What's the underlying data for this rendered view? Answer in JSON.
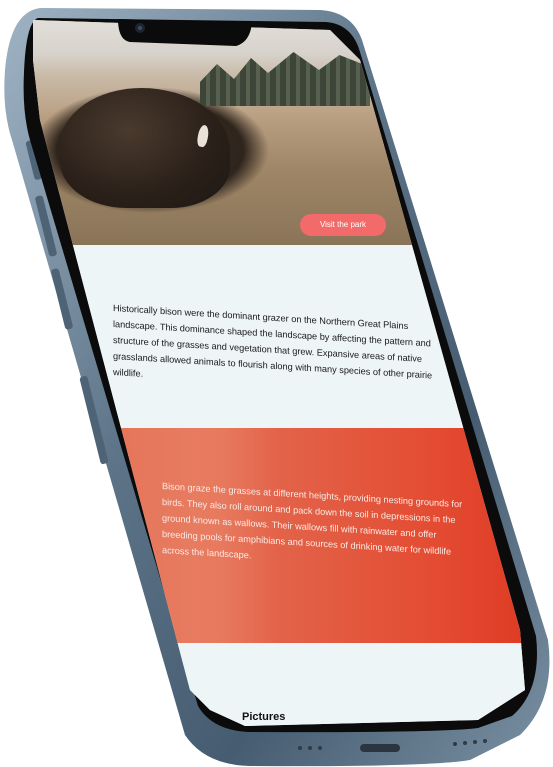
{
  "hero": {
    "visit_label": "Visit the park"
  },
  "section1": {
    "text": "Historically bison were the dominant grazer on the Northern Great Plains landscape. This dominance shaped the landscape by affecting the pattern and structure of the grasses and vegetation that grew. Expansive areas of native grasslands allowed animals to flourish along with many species of other prairie wildlife."
  },
  "section2": {
    "text": "Bison graze the grasses at different heights, providing nesting grounds for birds. They also roll around and pack down the soil in depressions in the ground known as wallows. Their wallows fill with rainwater and offer breeding pools for amphibians and sources of drinking water for wildlife across the landscape."
  },
  "section3": {
    "title": "Pictures"
  },
  "colors": {
    "accent_button": "#f26a6a",
    "light_background": "#eef5f7",
    "orange_background": "#dd4a2f",
    "device_frame": "#5f778c"
  }
}
